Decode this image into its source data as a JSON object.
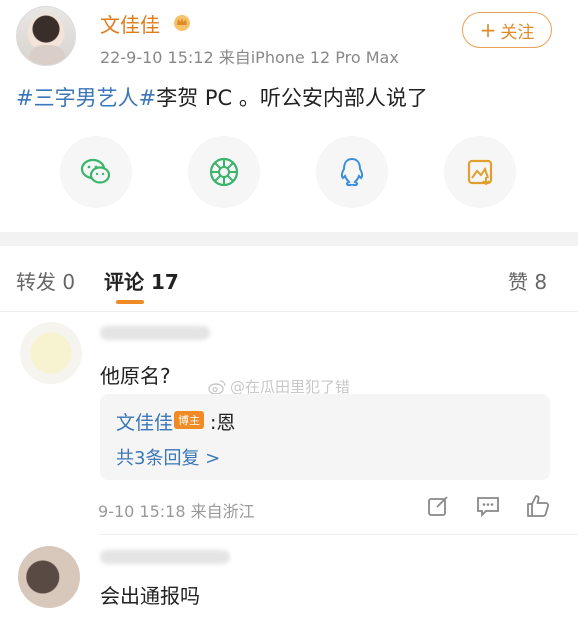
{
  "post": {
    "username": "文佳佳",
    "crown_icon": "vip-crown-icon",
    "meta": "22-9-10 15:12  来自iPhone 12 Pro Max",
    "follow_label": "关注",
    "follow_plus": "+",
    "text": {
      "hashtag1": "#三字男艺人#",
      "rest": "李贺 PC 。听公安内部人说了"
    }
  },
  "share": [
    {
      "icon": "wechat-icon",
      "color": "#3bb56b"
    },
    {
      "icon": "moments-icon",
      "color": "#3bb56b"
    },
    {
      "icon": "qq-icon",
      "color": "#3b8ed8"
    },
    {
      "icon": "save-image-icon",
      "color": "#e0a030"
    }
  ],
  "tabs": {
    "repost": "转发 0",
    "comments": "评论 17",
    "likes": "赞 8"
  },
  "comments": [
    {
      "text": "他原名?",
      "reply": {
        "author": "文佳佳",
        "badge": "博主",
        "text": ":恩",
        "more": "共3条回复 >"
      },
      "meta": "9-10 15:18  来自浙江"
    },
    {
      "text": "会出通报吗"
    }
  ],
  "watermark": "@在瓜田里犯了错"
}
